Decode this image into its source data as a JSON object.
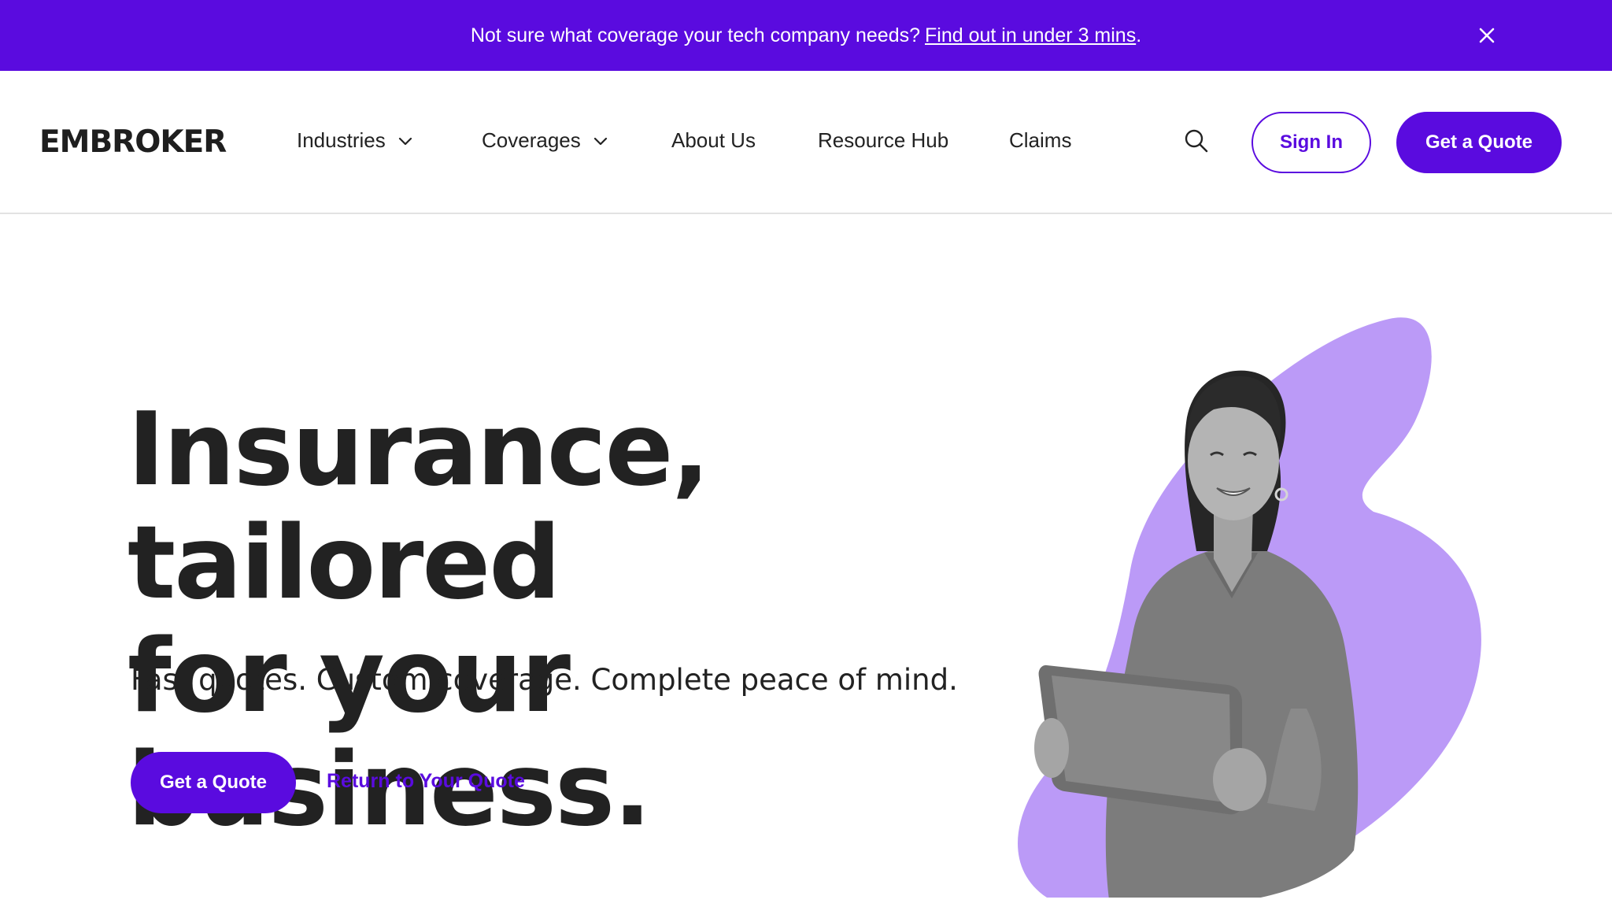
{
  "banner": {
    "text": "Not sure what coverage your tech company needs?",
    "link_text": "Find out in under 3 mins",
    "trailing": ".",
    "close_icon": "close-icon"
  },
  "header": {
    "logo": "EMBROKER",
    "nav": [
      {
        "label": "Industries",
        "has_dropdown": true
      },
      {
        "label": "Coverages",
        "has_dropdown": true
      },
      {
        "label": "About Us",
        "has_dropdown": false
      },
      {
        "label": "Resource Hub",
        "has_dropdown": false
      },
      {
        "label": "Claims",
        "has_dropdown": false
      }
    ],
    "search_icon": "search-icon",
    "sign_in_label": "Sign In",
    "quote_label": "Get a Quote"
  },
  "hero": {
    "title_line1": "Insurance, tailored",
    "title_line2": "for your business.",
    "subtitle": "Fast quotes. Custom coverage. Complete peace of mind.",
    "primary_cta": "Get a Quote",
    "secondary_cta": "Return to Your Quote"
  },
  "colors": {
    "brand": "#5a0bdf",
    "blob": "#bb9af7",
    "text": "#222222"
  }
}
